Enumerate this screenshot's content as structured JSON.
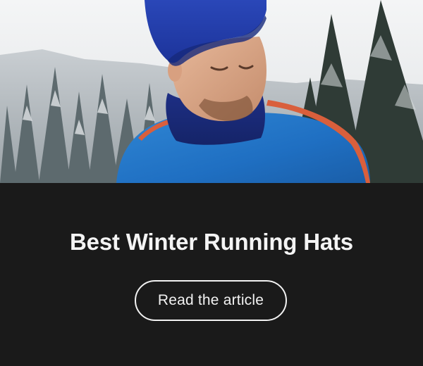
{
  "promo": {
    "title": "Best Winter Running Hats",
    "cta_label": "Read the article"
  },
  "colors": {
    "panel_background": "#1a1a1a",
    "text": "#f4f4f4",
    "button_border": "#f2f2f2"
  },
  "hero": {
    "image_subject": "man-in-blue-beanie-and-running-top-snowy-forest"
  }
}
